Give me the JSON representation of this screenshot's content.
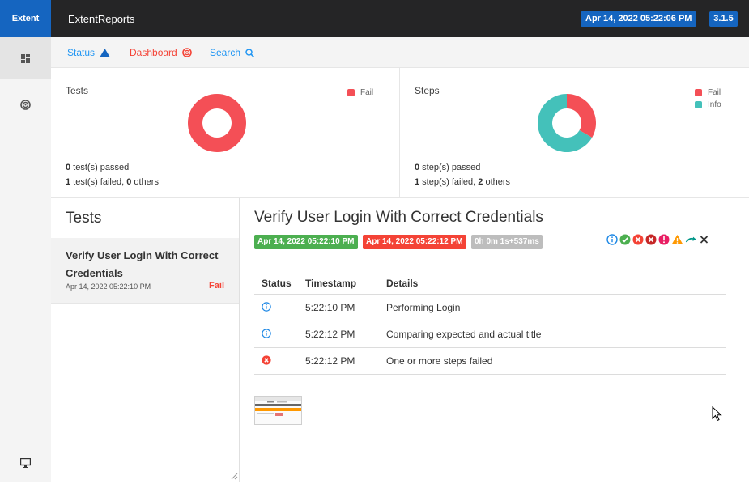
{
  "header": {
    "brand": "Extent",
    "report_name": "ExtentReports",
    "date": "Apr 14, 2022 05:22:06 PM",
    "version": "3.1.5"
  },
  "nav": {
    "status": "Status",
    "dashboard": "Dashboard",
    "search": "Search"
  },
  "dashboard": {
    "tests": {
      "title": "Tests",
      "legend": [
        {
          "label": "Fail",
          "color": "#f44f56"
        }
      ],
      "chart_data": {
        "type": "pie",
        "categories": [
          "Fail"
        ],
        "values": [
          1
        ]
      },
      "passed_count": "0",
      "passed_label": " test(s) passed",
      "failed_count": "1",
      "failed_label": " test(s) failed, ",
      "others_count": "0",
      "others_label": " others"
    },
    "steps": {
      "title": "Steps",
      "legend": [
        {
          "label": "Fail",
          "color": "#f44f56"
        },
        {
          "label": "Info",
          "color": "#44c1ba"
        }
      ],
      "chart_data": {
        "type": "pie",
        "categories": [
          "Fail",
          "Info"
        ],
        "values": [
          1,
          2
        ]
      },
      "passed_count": "0",
      "passed_label": " step(s) passed",
      "failed_count": "1",
      "failed_label": " step(s) failed, ",
      "others_count": "2",
      "others_label": " others"
    }
  },
  "tests_panel": {
    "heading": "Tests",
    "items": [
      {
        "name": "Verify User Login With Correct Credentials",
        "time": "Apr 14, 2022 05:22:10 PM",
        "status": "Fail"
      }
    ]
  },
  "detail": {
    "title": "Verify User Login With Correct Credentials",
    "start_time": "Apr 14, 2022 05:22:10 PM",
    "end_time": "Apr 14, 2022 05:22:12 PM",
    "duration": "0h 0m 1s+537ms",
    "status_filters": [
      "info-icon",
      "pass-icon",
      "fail-icon",
      "fatal-icon",
      "error-icon",
      "warning-icon",
      "skip-icon",
      "close-icon"
    ],
    "log_headers": {
      "status": "Status",
      "timestamp": "Timestamp",
      "details": "Details"
    },
    "logs": [
      {
        "status": "info",
        "timestamp": "5:22:10 PM",
        "details": "Performing Login"
      },
      {
        "status": "info",
        "timestamp": "5:22:12 PM",
        "details": "Comparing expected and actual title"
      },
      {
        "status": "fail",
        "timestamp": "5:22:12 PM",
        "details": "One or more steps failed"
      }
    ]
  },
  "colors": {
    "brand": "#1565c0",
    "topbar": "#252526",
    "fail": "#f44f56",
    "info": "#44c1ba",
    "pass": "#4caf50",
    "link": "#2196f3"
  }
}
